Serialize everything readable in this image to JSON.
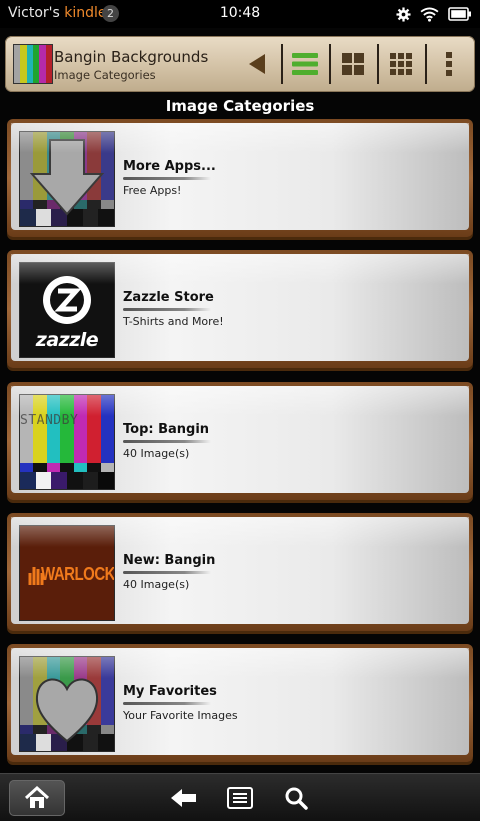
{
  "status_bar": {
    "owner_prefix": "Victor's ",
    "owner_brand": "kindle",
    "notification_count": "2",
    "time": "10:48",
    "icons": [
      "gear-icon",
      "wifi-icon",
      "battery-icon"
    ]
  },
  "action_bar": {
    "title": "Bangin Backgrounds",
    "subtitle": "Image Categories",
    "buttons": [
      "back-arrow-icon",
      "list-view-icon",
      "grid-view-large-icon",
      "grid-view-small-icon",
      "overflow-menu-icon"
    ],
    "colors": {
      "active_view": "#4fae2e",
      "bar_wood": "#d3c2a6"
    }
  },
  "section_title": "Image Categories",
  "categories": [
    {
      "name": "More Apps...",
      "description": "Free Apps!",
      "thumbnail": "down-arrow-test-pattern"
    },
    {
      "name": "Zazzle Store",
      "description": "T-Shirts and More!",
      "thumbnail": "zazzle-logo",
      "logo_text": "zazzle"
    },
    {
      "name": "Top: Bangin",
      "description": "40 Image(s)",
      "thumbnail": "standby-test-pattern",
      "overlay_text": "STANDBY"
    },
    {
      "name": "New: Bangin",
      "description": "40 Image(s)",
      "thumbnail": "warlock-logo",
      "logo_text": "WARLOCK"
    },
    {
      "name": "My Favorites",
      "description": "Your Favorite Images",
      "thumbnail": "heart-test-pattern"
    }
  ],
  "bottom_nav": {
    "buttons": [
      "home-icon",
      "back-icon",
      "menu-icon",
      "search-icon"
    ]
  },
  "colors": {
    "brand_orange": "#f08a2c",
    "wood_frame": "#8a5428",
    "warlock_orange": "#f07a1c"
  }
}
